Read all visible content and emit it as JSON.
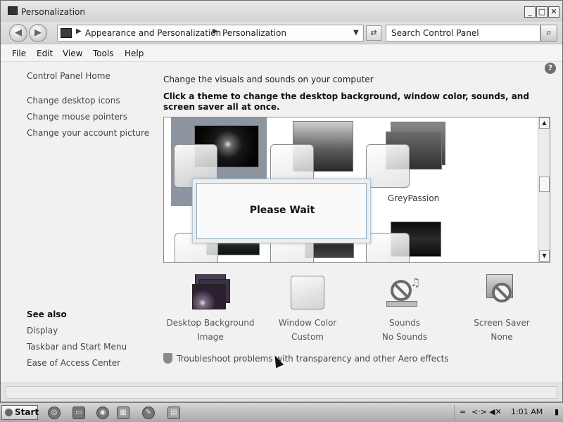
{
  "window": {
    "title": "Personalization",
    "controls": [
      "_",
      "□",
      "✕"
    ]
  },
  "address": {
    "crumbs": [
      "Appearance and Personalization",
      "Personalization"
    ],
    "search_placeholder": "Search Control Panel"
  },
  "menu": [
    "File",
    "Edit",
    "View",
    "Tools",
    "Help"
  ],
  "sidebar": {
    "home": "Control Panel Home",
    "links": [
      "Change desktop icons",
      "Change mouse pointers",
      "Change your account picture"
    ],
    "see_also_title": "See also",
    "see_also": [
      "Display",
      "Taskbar and Start Menu",
      "Ease of Access Center"
    ]
  },
  "main": {
    "intro": "Change the visuals and sounds on your computer",
    "instruction": "Click a theme to change the desktop background, window color, sounds, and screen saver all at once.",
    "themes": [
      {
        "label": "GreyPassion"
      }
    ],
    "dialog": "Please Wait",
    "settings": [
      {
        "name": "Desktop Background",
        "value": "Image",
        "icon": "desktop-background-icon"
      },
      {
        "name": "Window Color",
        "value": "Custom",
        "icon": "window-color-icon"
      },
      {
        "name": "Sounds",
        "value": "No Sounds",
        "icon": "sounds-icon"
      },
      {
        "name": "Screen Saver",
        "value": "None",
        "icon": "screen-saver-icon"
      }
    ],
    "troubleshoot": "Troubleshoot problems with transparency and other Aero effects"
  },
  "taskbar": {
    "start": "Start",
    "clock": "1:01 AM"
  }
}
